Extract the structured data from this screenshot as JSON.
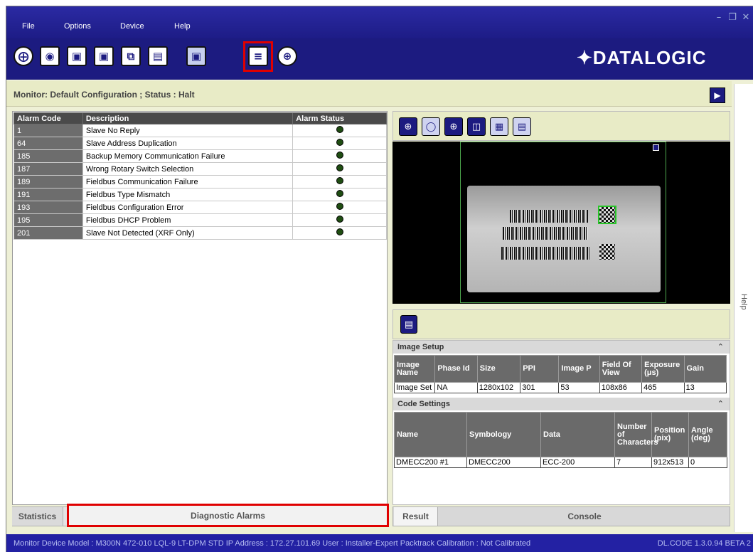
{
  "menu": {
    "file": "File",
    "options": "Options",
    "device": "Device",
    "help": "Help"
  },
  "window_controls": [
    "minimize-icon",
    "restore-icon",
    "close-icon"
  ],
  "toolbar": {
    "icons": [
      "crosshair-icon",
      "camera-settings-icon",
      "camera-export-icon",
      "camera-save-icon",
      "window-export-icon",
      "window-save-icon",
      "camera-disabled-icon",
      "monitor-active-icon",
      "target-icon"
    ],
    "brand": "✦DATALOGIC"
  },
  "monitor": {
    "text": "Monitor:  Default Configuration  ; Status :  Halt"
  },
  "alarms": {
    "headers": [
      "Alarm Code",
      "Description",
      "Alarm Status"
    ],
    "rows": [
      {
        "code": "1",
        "description": "Slave No Reply"
      },
      {
        "code": "64",
        "description": "Slave Address Duplication"
      },
      {
        "code": "185",
        "description": "Backup Memory Communication Failure"
      },
      {
        "code": "187",
        "description": "Wrong Rotary Switch Selection"
      },
      {
        "code": "189",
        "description": "Fieldbus Communication Failure"
      },
      {
        "code": "191",
        "description": "Fieldbus Type Mismatch"
      },
      {
        "code": "193",
        "description": "Fieldbus Configuration Error"
      },
      {
        "code": "195",
        "description": "Fieldbus DHCP Problem"
      },
      {
        "code": "201",
        "description": "Slave Not Detected (XRF Only)"
      }
    ],
    "status_color": "#1f4d12"
  },
  "left_tabs": {
    "statistics": "Statistics",
    "diagnostic": "Diagnostic Alarms"
  },
  "image_tools": [
    "zoom-in-icon",
    "zoom-100-icon",
    "zoom-fit-icon",
    "save-image-icon",
    "grid-icon",
    "layout-icon"
  ],
  "help_label": "Help",
  "image_setup": {
    "title": "Image Setup",
    "headers": [
      "Image Name",
      "Phase Id",
      "Size",
      "PPI",
      "Image P",
      "Field Of View",
      "Exposure (μs)",
      "Gain"
    ],
    "row": [
      "Image Set",
      "NA",
      "1280x102",
      "301",
      "53",
      "108x86",
      "465",
      "13"
    ]
  },
  "code_settings": {
    "title": "Code Settings",
    "headers": [
      "Name",
      "Symbology",
      "Data",
      "Number of Characters",
      "Position (pix)",
      "Angle (deg)"
    ],
    "row": [
      "DMECC200  #1",
      "DMECC200",
      "ECC-200",
      "7",
      "912x513",
      "0"
    ]
  },
  "right_tabs": {
    "result": "Result",
    "console": "Console"
  },
  "status": {
    "left": "Monitor  Device Model : M300N 472-010 LQL-9 LT-DPM STD   IP Address :  172.27.101.69   User : Installer-Expert   Packtrack Calibration : Not Calibrated",
    "right": "DL.CODE 1.3.0.94 BETA 2"
  },
  "colors": {
    "brand_blue": "#1c1b80",
    "highlight_red": "#e00000",
    "panel_green": "#e8ebc6"
  }
}
